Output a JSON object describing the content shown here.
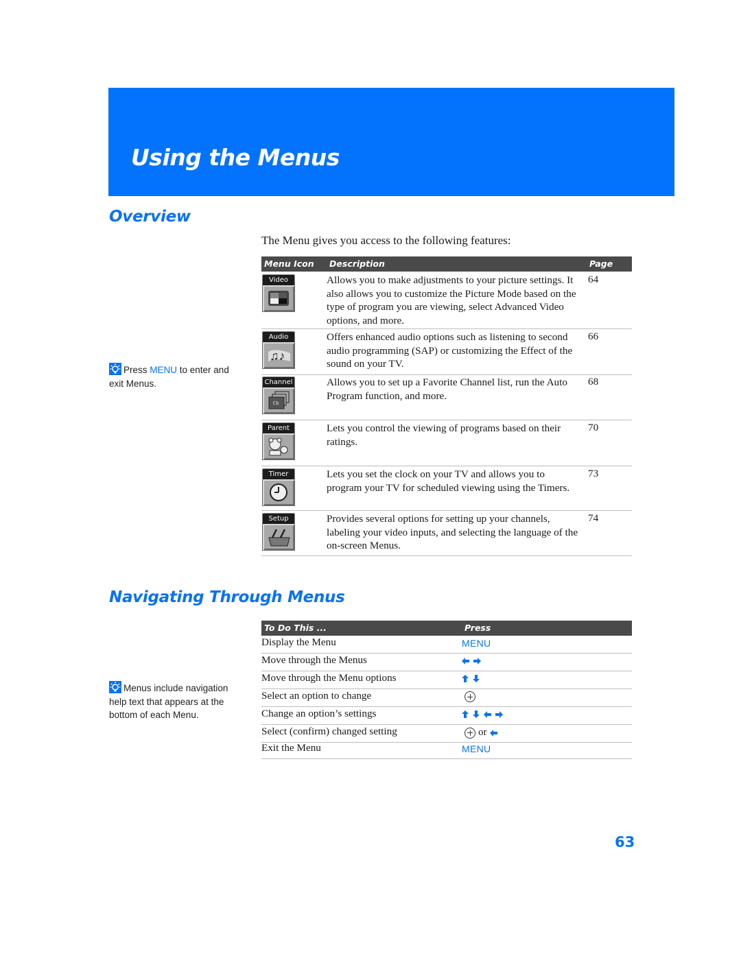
{
  "header": {
    "title": "Using the Menus"
  },
  "overview": {
    "title": "Overview",
    "intro": "The Menu gives you access to the following features:",
    "tip": {
      "icon": "lightbulb-tip-icon",
      "before": "Press ",
      "key": "MENU",
      "after": " to enter and exit Menus."
    },
    "table": {
      "headers": {
        "icon": "Menu Icon",
        "description": "Description",
        "page": "Page"
      },
      "rows": [
        {
          "icon_label": "Video",
          "icon": "video-menu-icon",
          "description": "Allows you to make adjustments to your picture settings. It also allows you to customize the Picture Mode based on the type of program you are viewing, select Advanced Video options, and more.",
          "page": "64"
        },
        {
          "icon_label": "Audio",
          "icon": "audio-menu-icon",
          "description": "Offers enhanced audio options such as listening to second audio programming (SAP) or customizing the Effect of the sound on your TV.",
          "page": "66"
        },
        {
          "icon_label": "Channel",
          "icon": "channel-menu-icon",
          "description": "Allows you to set up a Favorite Channel list, run the Auto Program function, and more.",
          "page": "68"
        },
        {
          "icon_label": "Parent",
          "icon": "parent-menu-icon",
          "description": "Lets you control the viewing of programs based on their ratings.",
          "page": "70"
        },
        {
          "icon_label": "Timer",
          "icon": "timer-menu-icon",
          "description": "Lets you set the clock on your TV and allows you to program your TV for scheduled viewing using the Timers.",
          "page": "73"
        },
        {
          "icon_label": "Setup",
          "icon": "setup-menu-icon",
          "description": "Provides several options for setting up your channels, labeling your video inputs, and selecting the language of the on-screen Menus.",
          "page": "74"
        }
      ]
    }
  },
  "navigating": {
    "title": "Navigating Through Menus",
    "tip": {
      "icon": "lightbulb-tip-icon",
      "text": "Menus include navigation help text that appears at the bottom of each Menu."
    },
    "table": {
      "headers": {
        "action": "To Do This ...",
        "press": "Press"
      },
      "rows": [
        {
          "action": "Display the Menu",
          "press": "MENU"
        },
        {
          "action": "Move through the Menus",
          "press": "left-right-arrows"
        },
        {
          "action": "Move through the Menu options",
          "press": "up-down-arrows"
        },
        {
          "action": "Select an option to change",
          "press": "select-button"
        },
        {
          "action": "Change an option’s settings",
          "press": "all-arrows"
        },
        {
          "action": "Select (confirm) changed setting",
          "press": "select-or-left",
          "or": "or"
        },
        {
          "action": "Exit the Menu",
          "press": "MENU"
        }
      ]
    }
  },
  "colors": {
    "accent": "#0a72f0",
    "banner": "#0373fd",
    "table_header": "#4a4a4a"
  },
  "page_number": "63"
}
